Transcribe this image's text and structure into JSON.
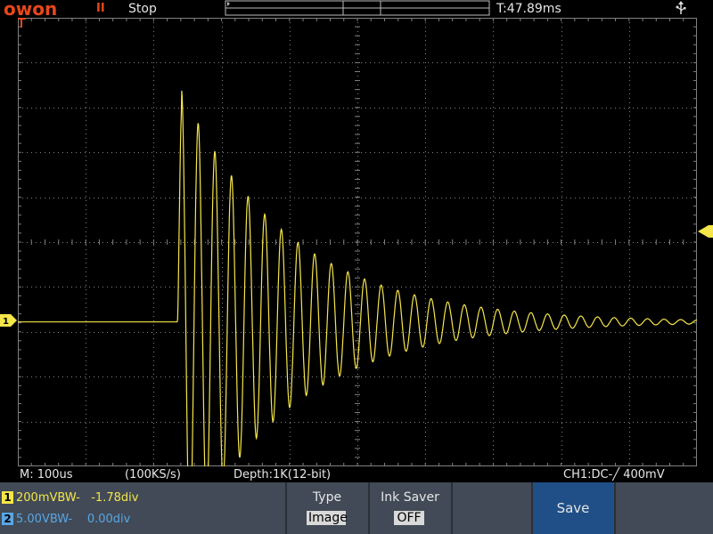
{
  "header": {
    "logo": "owon",
    "run_icon": "II",
    "run_status": "Stop",
    "trigger_time": "T:47.89ms"
  },
  "status": {
    "timebase": "M: 100us",
    "sample_rate": "(100KS/s)",
    "depth": "Depth:1K(12-bit)",
    "channel_info": "CH1:DC-╱ 400mV"
  },
  "channels": [
    {
      "number": "1",
      "text": "200mVBW-   -1.78div",
      "color": "#f5e64a"
    },
    {
      "number": "2",
      "text": "5.00VBW-    0.00div",
      "color": "#58a6e6"
    }
  ],
  "menu": {
    "type_label": "Type",
    "type_value": "Image",
    "ink_saver_label": "Ink Saver",
    "ink_saver_value": "OFF",
    "save_label": "Save"
  },
  "colors": {
    "brand": "#e8471a",
    "trace_ch1": "#f5e64a",
    "grid": "#808080",
    "menu_bg": "#414a56",
    "save_bg": "#1f4f86"
  },
  "waveform": {
    "description_free": true,
    "type": "damped-oscillation",
    "baseline_div": -1.78,
    "onset_time_div": 2.35,
    "first_peak_div": 3.59,
    "first_trough_div": -1.74,
    "period_div": 0.245,
    "decay_constant_div": 1.6
  }
}
